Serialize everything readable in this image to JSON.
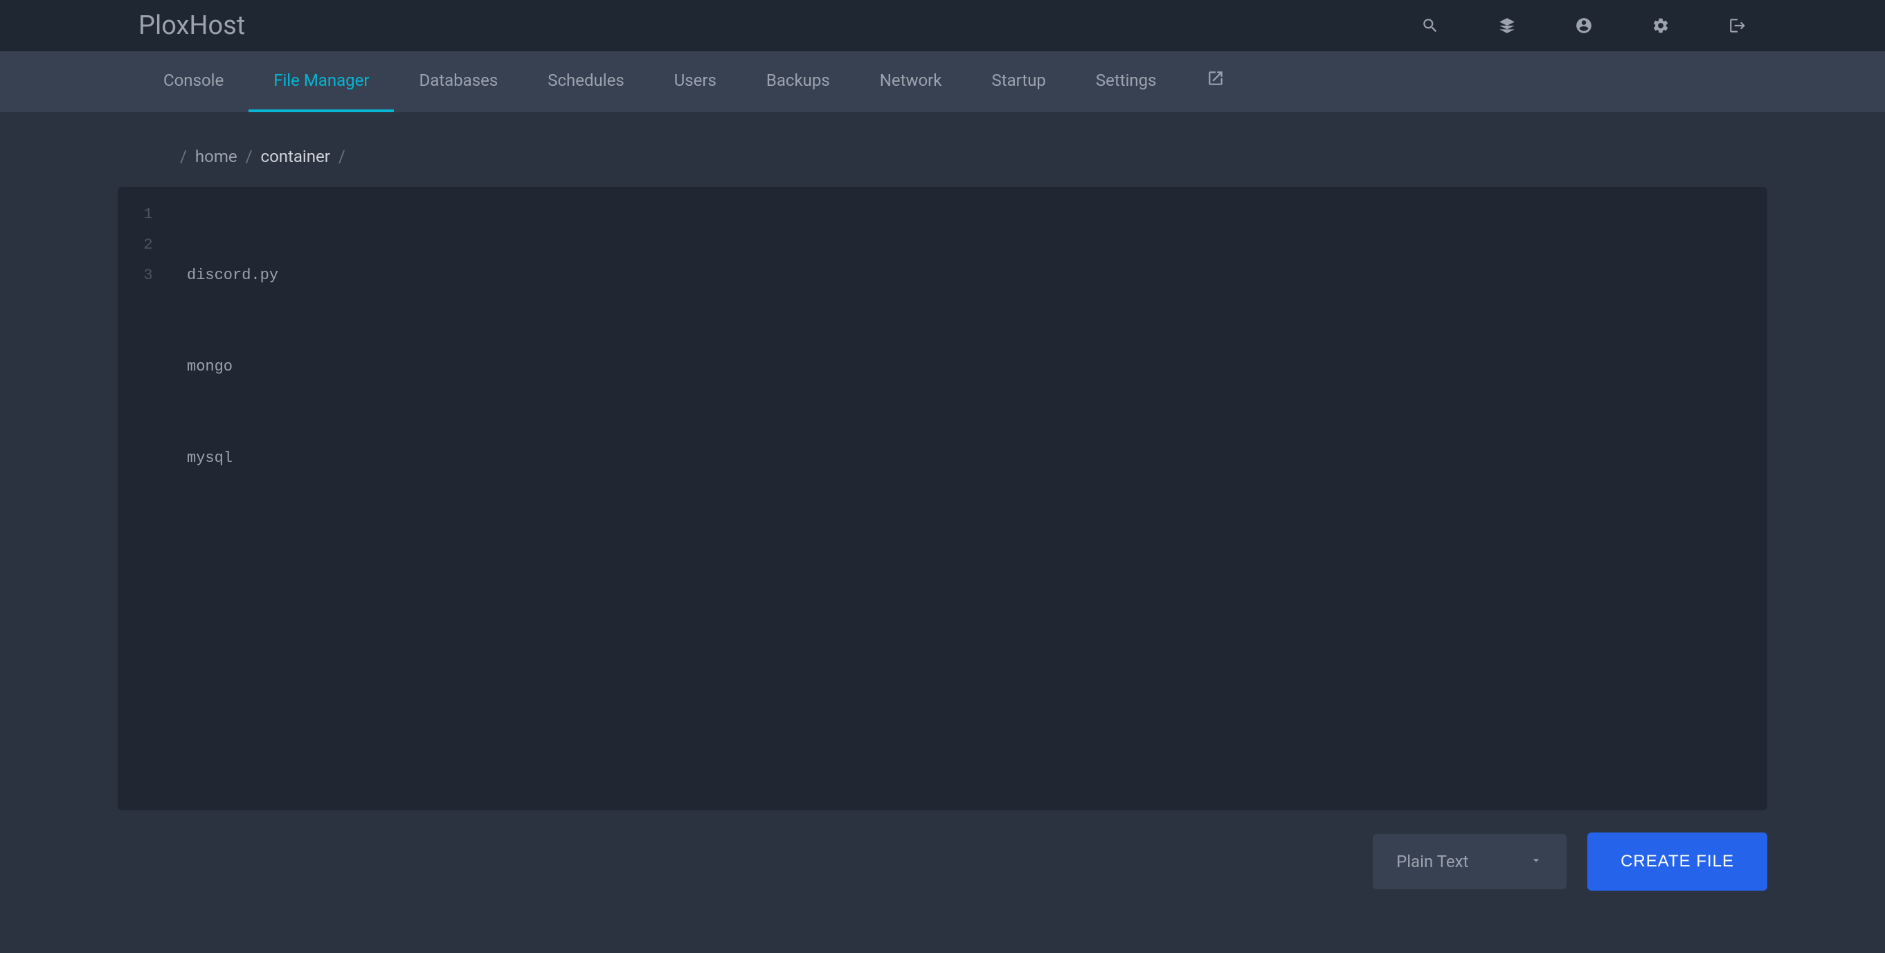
{
  "brand": "PloxHost",
  "header_icons": [
    "search-icon",
    "layers-icon",
    "user-icon",
    "cog-icon",
    "logout-icon"
  ],
  "tabs": [
    {
      "label": "Console",
      "active": false,
      "icon": null
    },
    {
      "label": "File Manager",
      "active": true,
      "icon": null
    },
    {
      "label": "Databases",
      "active": false,
      "icon": null
    },
    {
      "label": "Schedules",
      "active": false,
      "icon": null
    },
    {
      "label": "Users",
      "active": false,
      "icon": null
    },
    {
      "label": "Backups",
      "active": false,
      "icon": null
    },
    {
      "label": "Network",
      "active": false,
      "icon": null
    },
    {
      "label": "Startup",
      "active": false,
      "icon": null
    },
    {
      "label": "Settings",
      "active": false,
      "icon": null
    },
    {
      "label": "",
      "active": false,
      "icon": "external-link-icon"
    }
  ],
  "breadcrumb": {
    "items": [
      "home",
      "container"
    ],
    "sep": "/"
  },
  "editor": {
    "lines": [
      "discord.py",
      "mongo",
      "mysql"
    ]
  },
  "footer": {
    "syntax_selected": "Plain Text",
    "create_label": "CREATE FILE"
  }
}
